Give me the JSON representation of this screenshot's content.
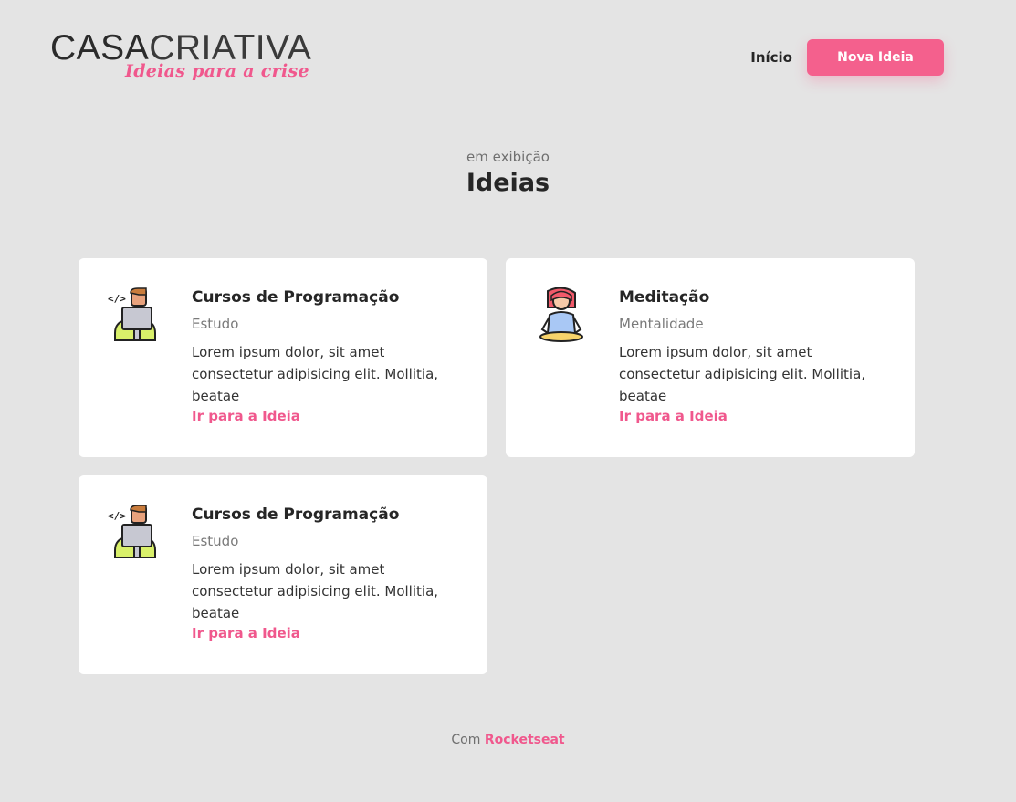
{
  "header": {
    "logo_part1": "CASA",
    "logo_part2": "CRIATIVA",
    "logo_tagline": "Ideias para a crise",
    "nav_home": "Início",
    "new_idea_button": "Nova Ideia"
  },
  "section": {
    "pretitle": "em exibição",
    "title": "Ideias"
  },
  "ideas": [
    {
      "icon": "programmer-icon",
      "title": "Cursos de Programação",
      "category": "Estudo",
      "description": "Lorem ipsum dolor, sit amet consectetur adipisicing elit. Mollitia, beatae",
      "link": "Ir para a Ideia"
    },
    {
      "icon": "meditation-icon",
      "title": "Meditação",
      "category": "Mentalidade",
      "description": "Lorem ipsum dolor, sit amet consectetur adipisicing elit. Mollitia, beatae",
      "link": "Ir para a Ideia"
    },
    {
      "icon": "programmer-icon",
      "title": "Cursos de Programação",
      "category": "Estudo",
      "description": "Lorem ipsum dolor, sit amet consectetur adipisicing elit. Mollitia, beatae",
      "link": "Ir para a Ideia"
    }
  ],
  "footer": {
    "prefix": "Com",
    "brand": "Rocketseat"
  },
  "colors": {
    "background": "#e4e4e4",
    "accent": "#f4608d",
    "card": "#ffffff",
    "text": "#262626"
  }
}
